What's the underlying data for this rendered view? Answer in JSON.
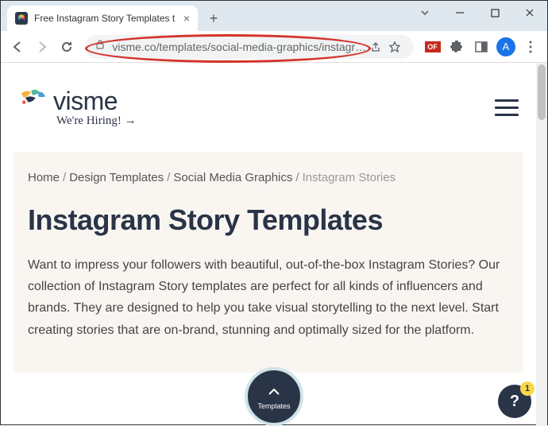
{
  "browser": {
    "tab_title": "Free Instagram Story Templates t",
    "url": "visme.co/templates/social-media-graphics/instagr…",
    "extension_label": "OF",
    "avatar_letter": "A"
  },
  "header": {
    "logo_text": "visme",
    "hiring_text": "We're Hiring! →"
  },
  "breadcrumb": {
    "items": [
      "Home",
      "Design Templates",
      "Social Media Graphics"
    ],
    "current": "Instagram Stories"
  },
  "main": {
    "title": "Instagram Story Templates",
    "description": "Want to impress your followers with beautiful, out-of-the-box Instagram Stories? Our collection of Instagram Story templates are perfect for all kinds of influencers and brands. They are designed to help you take visual storytelling to the next level. Start creating stories that are on-brand, stunning and optimally sized for the platform."
  },
  "fab": {
    "templates_label": "Templates"
  },
  "help": {
    "symbol": "?",
    "badge": "1"
  }
}
